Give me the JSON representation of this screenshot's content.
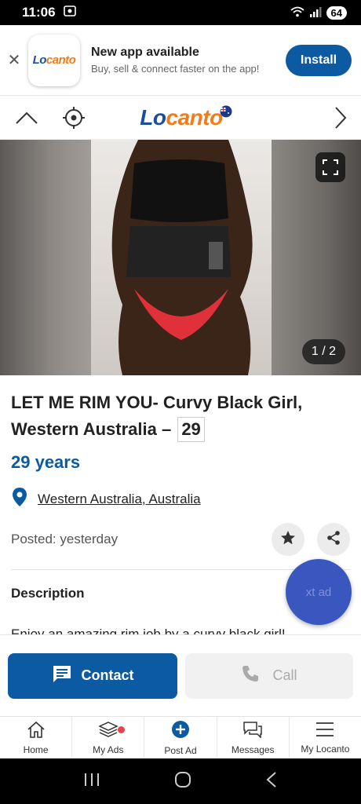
{
  "status_bar": {
    "time": "11:06",
    "battery": "64"
  },
  "banner": {
    "logo_part1": "Lo",
    "logo_part2": "canto",
    "title": "New app available",
    "subtitle": "Buy, sell & connect faster on the app!",
    "install_label": "Install",
    "close_icon": "close-icon"
  },
  "nav": {
    "logo_part1": "Lo",
    "logo_part2": "canto",
    "icons": [
      "chevron-up-icon",
      "location-target-icon",
      "chevron-right-icon"
    ]
  },
  "photo": {
    "counter": "1 / 2",
    "fullscreen_icon": "fullscreen-icon"
  },
  "ad": {
    "title": "LET ME RIM YOU- Curvy Black Girl, Western Australia –",
    "title_age": "29",
    "age": "29 years",
    "location_region": "Western Australia",
    "location_country": "Australia",
    "posted": "Posted: yesterday",
    "description_heading": "Description",
    "description": "Enjoy an amazing rim job by a curvy black girl!",
    "next_ad_label": "xt ad"
  },
  "actions": {
    "contact_label": "Contact",
    "call_label": "Call"
  },
  "bottom_nav": [
    {
      "label": "Home",
      "icon": "home-icon"
    },
    {
      "label": "My Ads",
      "icon": "stack-icon"
    },
    {
      "label": "Post Ad",
      "icon": "plus-circle-icon"
    },
    {
      "label": "Messages",
      "icon": "messages-icon"
    },
    {
      "label": "My Locanto",
      "icon": "menu-icon"
    }
  ],
  "colors": {
    "brand_blue": "#0b5aa2",
    "brand_orange": "#f07d1a",
    "fab": "#3a57c0"
  }
}
